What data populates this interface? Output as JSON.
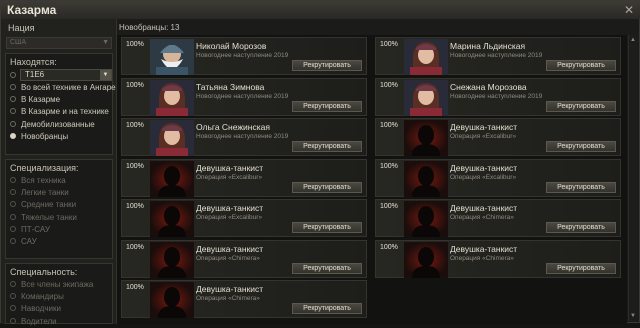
{
  "window": {
    "title": "Казарма"
  },
  "left": {
    "nation_label": "Нация",
    "nation_value": "США",
    "location_label": "Находятся:",
    "tank_value": "T1E6",
    "location_options": [
      {
        "label": "Во всей технике в Ангаре",
        "selected": false
      },
      {
        "label": "В Казарме",
        "selected": false
      },
      {
        "label": "В Казарме и на технике",
        "selected": false
      },
      {
        "label": "Демобилизованные",
        "selected": false
      },
      {
        "label": "Новобранцы",
        "selected": true
      }
    ],
    "spec_label": "Специализация:",
    "spec_options": [
      "Вся техника",
      "Легкие танки",
      "Средние танки",
      "Тяжелые танки",
      "ПТ-САУ",
      "САУ"
    ],
    "role_label": "Специальность:",
    "role_options": [
      "Все члены экипажа",
      "Командиры",
      "Наводчики",
      "Водители"
    ]
  },
  "main": {
    "count": "Новобранцы: 13",
    "recruit_label": "Рекрутировать",
    "cards": [
      {
        "pct": "100%",
        "name": "Николай Морозов",
        "sub": "Новогоднее наступление 2019",
        "type": "santa"
      },
      {
        "pct": "100%",
        "name": "Марина Льдинская",
        "sub": "Новогоднее наступление 2019",
        "type": "woman"
      },
      {
        "pct": "100%",
        "name": "Татьяна Зимнова",
        "sub": "Новогоднее наступление 2019",
        "type": "woman"
      },
      {
        "pct": "100%",
        "name": "Снежана Морозова",
        "sub": "Новогоднее наступление 2019",
        "type": "woman"
      },
      {
        "pct": "100%",
        "name": "Ольга Снежинская",
        "sub": "Новогоднее наступление 2019",
        "type": "woman"
      },
      {
        "pct": "100%",
        "name": "Девушка-танкист",
        "sub": "Операция «Excalibur»",
        "type": "silhouette"
      },
      {
        "pct": "100%",
        "name": "Девушка-танкист",
        "sub": "Операция «Excalibur»",
        "type": "silhouette"
      },
      {
        "pct": "100%",
        "name": "Девушка-танкист",
        "sub": "Операция «Excalibur»",
        "type": "silhouette"
      },
      {
        "pct": "100%",
        "name": "Девушка-танкист",
        "sub": "Операция «Excalibur»",
        "type": "silhouette"
      },
      {
        "pct": "100%",
        "name": "Девушка-танкист",
        "sub": "Операция «Chimera»",
        "type": "silhouette"
      },
      {
        "pct": "100%",
        "name": "Девушка-танкист",
        "sub": "Операция «Chimera»",
        "type": "silhouette"
      },
      {
        "pct": "100%",
        "name": "Девушка-танкист",
        "sub": "Операция «Chimera»",
        "type": "silhouette"
      },
      {
        "pct": "100%",
        "name": "Девушка-танкист",
        "sub": "Операция «Chimera»",
        "type": "silhouette"
      }
    ]
  },
  "colors": {
    "accent": "#c9c6bd",
    "silhouette_glow": "#8a1a12"
  }
}
